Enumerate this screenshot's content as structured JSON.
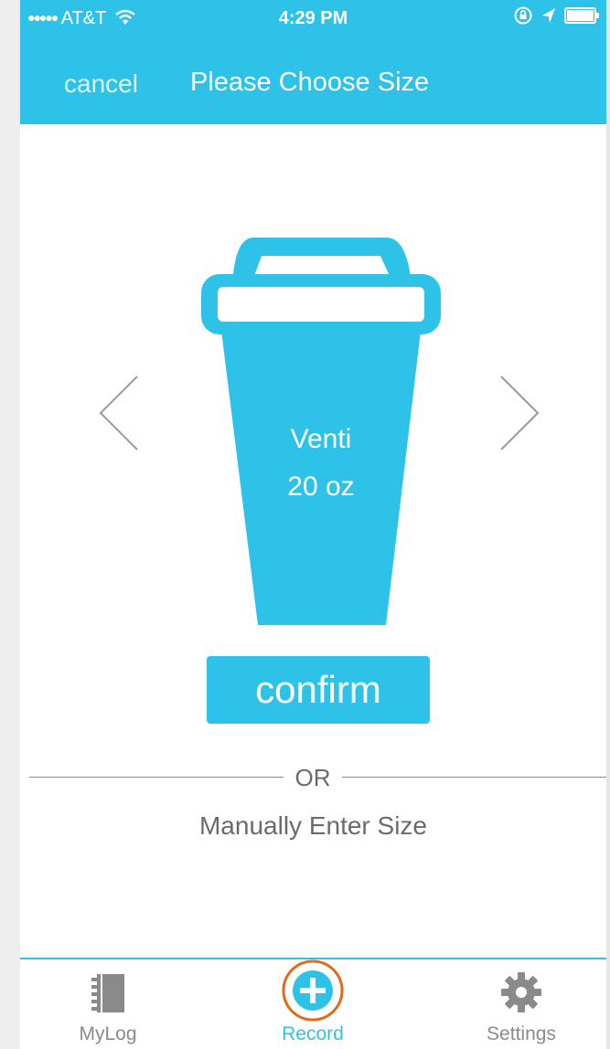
{
  "status_bar": {
    "signal_dots": "●●●●●",
    "carrier": "AT&T",
    "time": "4:29 PM"
  },
  "nav": {
    "cancel_label": "cancel",
    "title": "Please Choose Size"
  },
  "cup": {
    "name": "Venti",
    "size": "20 oz"
  },
  "confirm_label": "confirm",
  "divider_label": "OR",
  "manual_link": "Manually Enter Size",
  "tabs": [
    {
      "label": "MyLog",
      "icon": "notebook-icon"
    },
    {
      "label": "Record",
      "icon": "add-circle-icon"
    },
    {
      "label": "Settings",
      "icon": "gear-icon"
    }
  ],
  "colors": {
    "accent": "#2ec2e8",
    "highlight_ring": "#e06a1e",
    "text_gray": "#6b6b6b"
  }
}
